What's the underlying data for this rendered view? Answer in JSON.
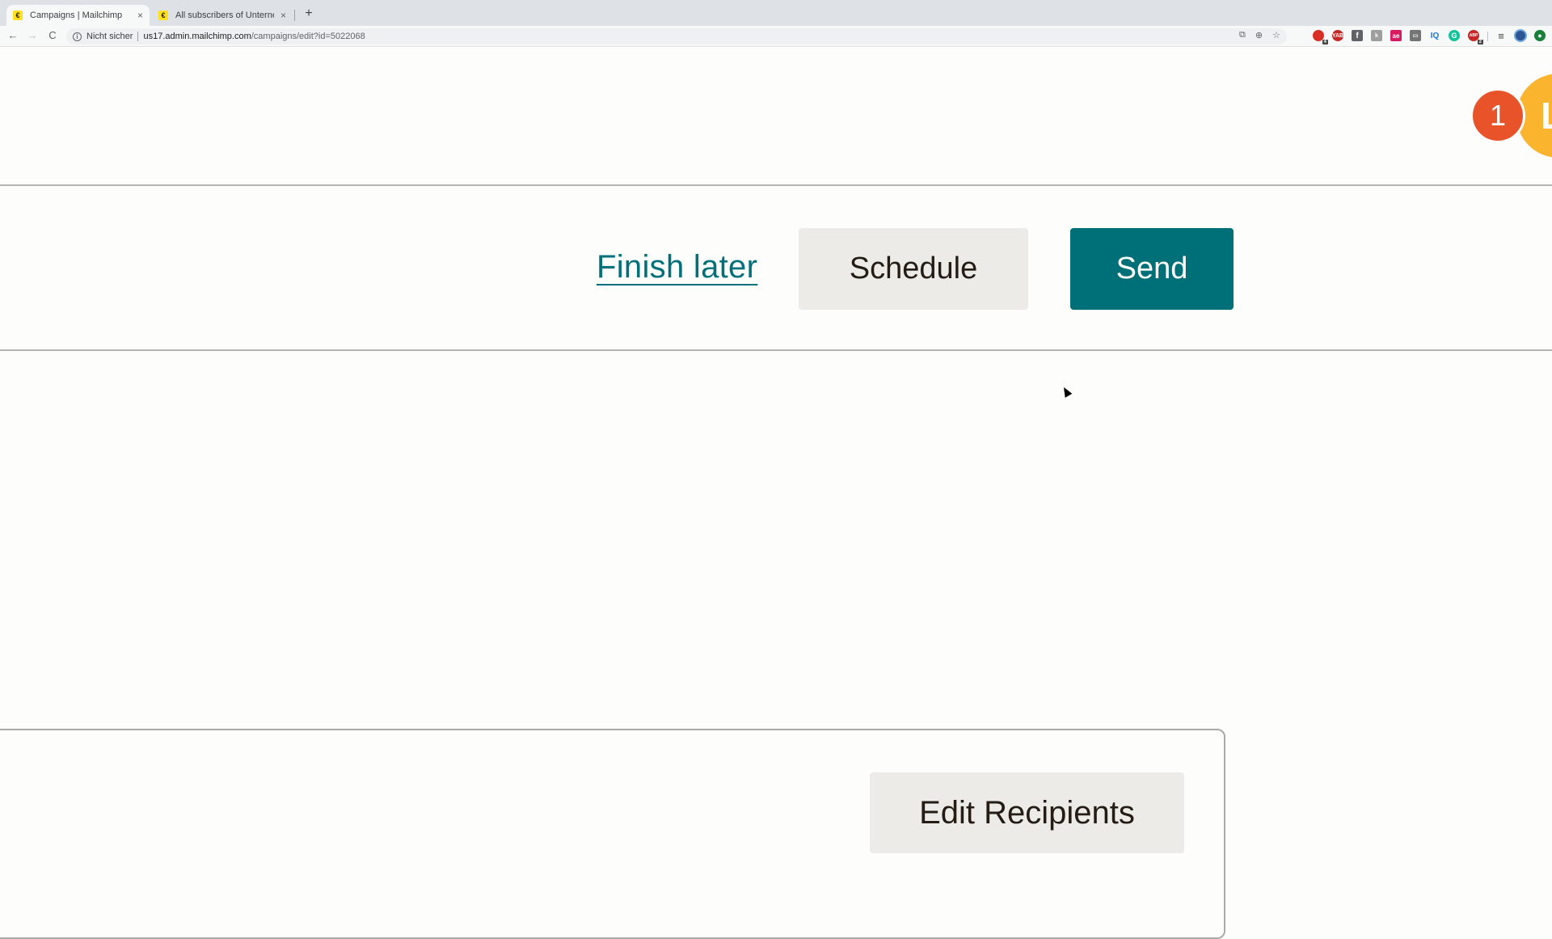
{
  "browser": {
    "tabs": [
      {
        "title": "Campaigns | Mailchimp",
        "favicon": "mailchimp-icon",
        "active": true
      },
      {
        "title": "All subscribers of Unternehmen",
        "favicon": "mailchimp-icon",
        "active": false
      }
    ],
    "new_tab_label": "+",
    "close_label": "×",
    "nav": {
      "back": "←",
      "forward": "→",
      "reload": "C"
    },
    "security_label": "Nicht sicher",
    "url_host": "us17.admin.mailchimp.com",
    "url_path": "/campaigns/edit?id=5022068",
    "omnibox_icons": [
      "translate-icon",
      "zoom-icon",
      "bookmark-star-icon"
    ],
    "extensions": [
      {
        "name": "extension-1-icon",
        "label": "",
        "color": "#d93025",
        "badge": "4"
      },
      {
        "name": "extension-yab-icon",
        "label": "YAB",
        "color": "#c62828",
        "badge": ""
      },
      {
        "name": "extension-facebook-icon",
        "label": "f",
        "color": "#5f6368",
        "badge": ""
      },
      {
        "name": "extension-grey-icon",
        "label": "k",
        "color": "#9e9e9e",
        "badge": ""
      },
      {
        "name": "extension-ae-icon",
        "label": "ae",
        "color": "#d81b60",
        "badge": ""
      },
      {
        "name": "extension-tag-icon",
        "label": "▭",
        "color": "#757575",
        "badge": ""
      },
      {
        "name": "extension-iq-icon",
        "label": "IQ",
        "color": "#1a73e8",
        "badge": ""
      },
      {
        "name": "extension-grammarly-icon",
        "label": "G",
        "color": "#15c39a",
        "badge": ""
      },
      {
        "name": "extension-adblock-icon",
        "label": "ABP",
        "color": "#c62828",
        "badge": "2"
      }
    ],
    "media_icon": "≡",
    "profile_icon": "profile-avatar",
    "update_icon": "update-icon"
  },
  "header": {
    "notification_count": "1",
    "avatar_initial": "L"
  },
  "actions": {
    "finish_later": "Finish later",
    "schedule": "Schedule",
    "send": "Send"
  },
  "recipients": {
    "edit_label": "Edit Recipients"
  },
  "colors": {
    "brand_teal": "#007078",
    "notification": "#e8532a",
    "avatar": "#fbb42d"
  }
}
